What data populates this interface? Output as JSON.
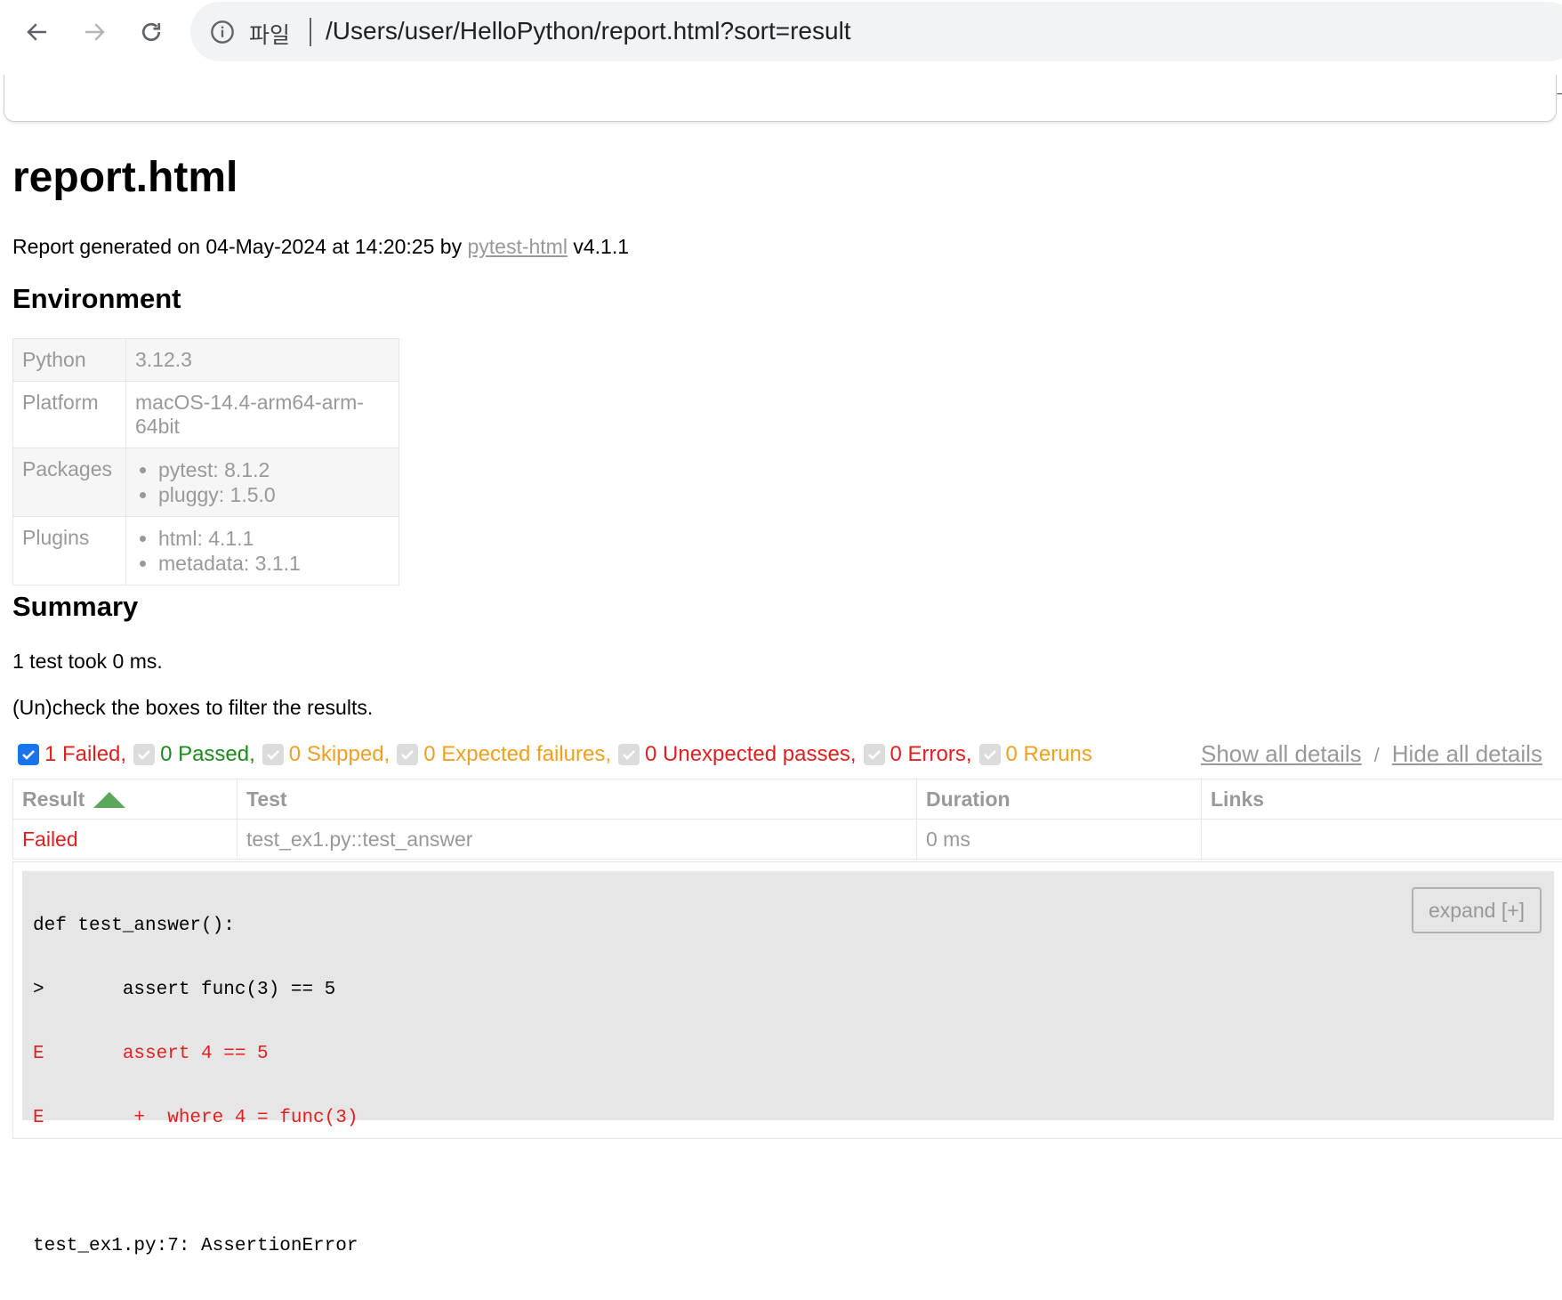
{
  "browser": {
    "site_label": "파일",
    "url": "/Users/user/HelloPython/report.html?sort=result",
    "panel_mark": "ᄀ"
  },
  "report": {
    "title": "report.html",
    "generated_prefix": "Report generated on 04-May-2024 at 14:20:25 by ",
    "generator_link": "pytest-html",
    "generator_version": " v4.1.1"
  },
  "environment": {
    "heading": "Environment",
    "rows": [
      {
        "key": "Python",
        "value": "3.12.3"
      },
      {
        "key": "Platform",
        "value": "macOS-14.4-arm64-arm-64bit"
      },
      {
        "key": "Packages",
        "items": [
          "pytest: 8.1.2",
          "pluggy: 1.5.0"
        ]
      },
      {
        "key": "Plugins",
        "items": [
          "html: 4.1.1",
          "metadata: 3.1.1"
        ]
      }
    ]
  },
  "summary": {
    "heading": "Summary",
    "test_count": "1 test took 0 ms.",
    "filter_hint": "(Un)check the boxes to filter the results.",
    "filters": [
      {
        "label": "1 Failed,",
        "checked": true,
        "color": "#e02020"
      },
      {
        "label": "0 Passed,",
        "checked": false,
        "color": "#1c8a1c"
      },
      {
        "label": "0 Skipped,",
        "checked": false,
        "color": "#f0a020"
      },
      {
        "label": "0 Expected failures,",
        "checked": false,
        "color": "#f0a020"
      },
      {
        "label": "0 Unexpected passes,",
        "checked": false,
        "color": "#e02020"
      },
      {
        "label": "0 Errors,",
        "checked": false,
        "color": "#e02020"
      },
      {
        "label": "0 Reruns",
        "checked": false,
        "color": "#f0a020"
      }
    ],
    "show_all": "Show all details",
    "separator": "/",
    "hide_all": "Hide all details"
  },
  "results": {
    "headers": [
      "Result",
      "Test",
      "Duration",
      "Links"
    ],
    "rows": [
      {
        "result": "Failed",
        "test": "test_ex1.py::test_answer",
        "duration": "0 ms",
        "links": ""
      }
    ],
    "log_lines": [
      {
        "text": "def test_answer():",
        "err": false
      },
      {
        "text": ">       assert func(3) == 5",
        "err": false
      },
      {
        "text": "E       assert 4 == 5",
        "err": true
      },
      {
        "text": "E        +  where 4 = func(3)",
        "err": true
      },
      {
        "text": "",
        "err": false
      },
      {
        "text": "test_ex1.py:7: AssertionError",
        "err": false
      }
    ],
    "expand_label": "expand [+]"
  }
}
